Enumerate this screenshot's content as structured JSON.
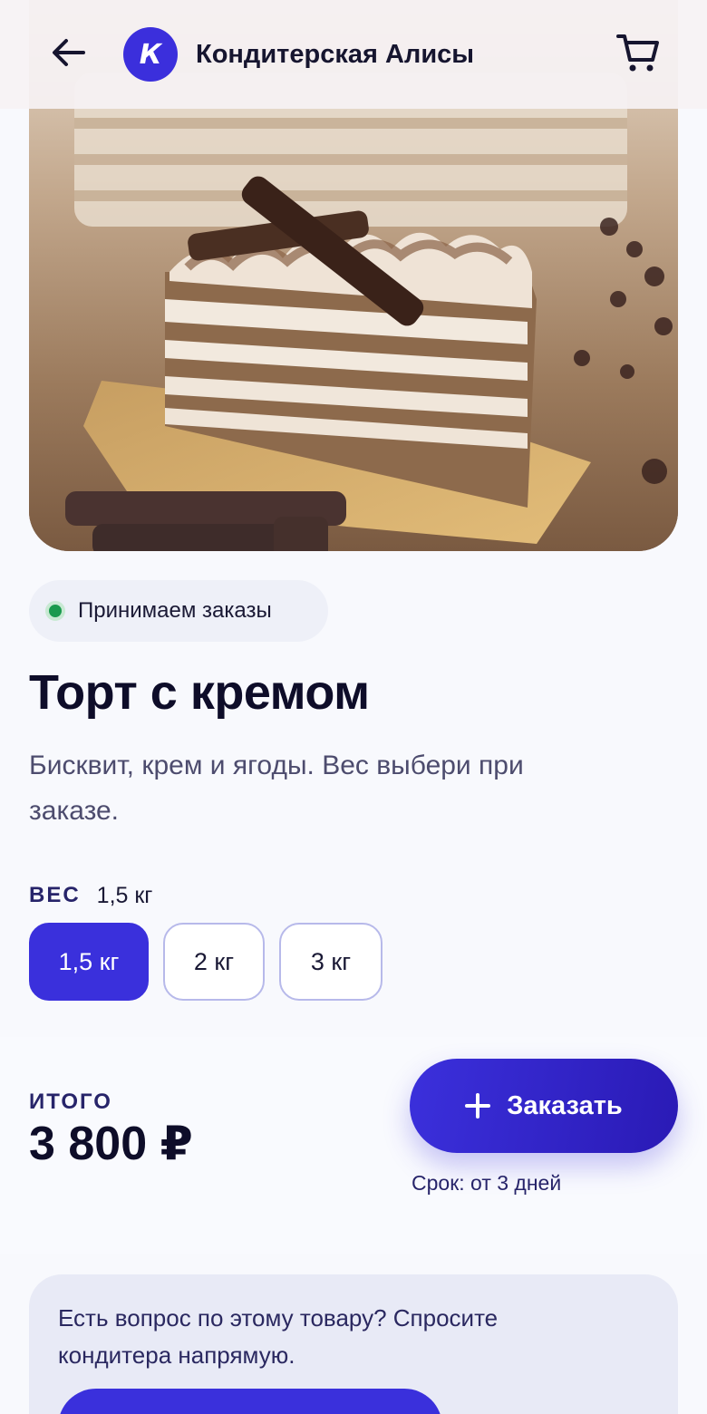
{
  "header": {
    "back_icon": "arrow-left-icon",
    "shop_initial": "К",
    "shop_name": "Кондитерская Алисы",
    "cart_icon": "cart-icon",
    "avatar_color": "#3b2fdc"
  },
  "product": {
    "image_alt": "layered cake slice photo",
    "status": "Принимаем заказы",
    "status_color": "#1a9a4e",
    "title": "Торт с кремом",
    "description": "Бисквит, крем и ягоды. Вес выбери при заказе."
  },
  "weight": {
    "label": "ВЕС",
    "selected": "1,5 кг",
    "options": [
      "1,5 кг",
      "2 кг",
      "3 кг"
    ],
    "selected_index": 0
  },
  "order": {
    "total_label": "ИТОГО",
    "total_price": "3 800 ₽",
    "button_label": "Заказать",
    "button_icon": "plus-icon",
    "delivery_note": "Срок: от 3 дней",
    "accent_color": "#3a30dc"
  },
  "question": {
    "text": "Есть вопрос по этому товару? Спросите кондитера напрямую."
  }
}
